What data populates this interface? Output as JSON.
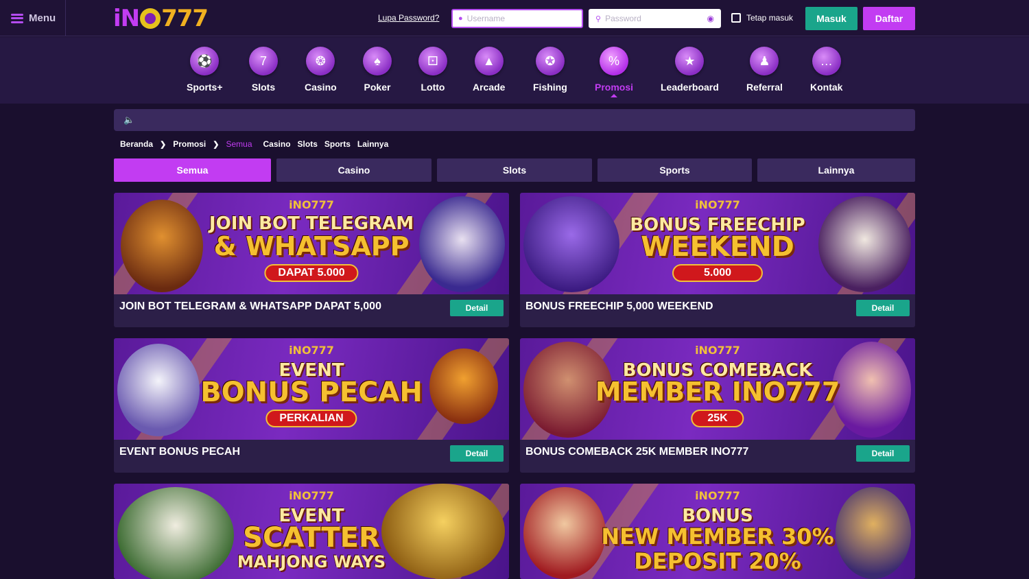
{
  "header": {
    "menu_label": "Menu",
    "logo_text_a": "iN",
    "logo_text_b": "777",
    "forgot_password": "Lupa Password?",
    "username_placeholder": "Username",
    "password_placeholder": "Password",
    "remember_label": "Tetap masuk",
    "login_label": "Masuk",
    "register_label": "Daftar"
  },
  "nav": [
    {
      "label": "Sports+",
      "icon": "sports-icon"
    },
    {
      "label": "Slots",
      "icon": "slots-icon"
    },
    {
      "label": "Casino",
      "icon": "casino-icon"
    },
    {
      "label": "Poker",
      "icon": "poker-icon"
    },
    {
      "label": "Lotto",
      "icon": "lotto-icon"
    },
    {
      "label": "Arcade",
      "icon": "arcade-icon"
    },
    {
      "label": "Fishing",
      "icon": "fishing-icon"
    },
    {
      "label": "Promosi",
      "icon": "promo-icon",
      "active": true
    },
    {
      "label": "Leaderboard",
      "icon": "trophy-icon"
    },
    {
      "label": "Referral",
      "icon": "referral-icon"
    },
    {
      "label": "Kontak",
      "icon": "chat-icon"
    }
  ],
  "breadcrumb": [
    "Beranda",
    "Promosi",
    "Semua",
    "Casino",
    "Slots",
    "Sports",
    "Lainnya"
  ],
  "tabs": [
    "Semua",
    "Casino",
    "Slots",
    "Sports",
    "Lainnya"
  ],
  "colors": {
    "accent": "#c23cf2",
    "green": "#1aa58b",
    "bg": "#1a0f2e"
  },
  "promos": [
    {
      "brand": "iNO777",
      "line1": "JOIN BOT TELEGRAM",
      "line2": "& WHATSAPP",
      "pill": "DAPAT 5.000",
      "title": "JOIN BOT TELEGRAM & WHATSAPP DAPAT 5,000",
      "detail": "Detail"
    },
    {
      "brand": "iNO777",
      "line1": "BONUS FREECHIP",
      "line2": "WEEKEND",
      "pill": "5.000",
      "title": "BONUS FREECHIP 5,000 WEEKEND",
      "detail": "Detail"
    },
    {
      "brand": "iNO777",
      "line1": "EVENT",
      "line2": "BONUS PECAH",
      "pill": "PERKALIAN",
      "title": "EVENT BONUS PECAH",
      "detail": "Detail"
    },
    {
      "brand": "iNO777",
      "line1": "BONUS COMEBACK",
      "line2": "MEMBER INO777",
      "pill": "25K",
      "title": "BONUS COMEBACK 25K MEMBER INO777",
      "detail": "Detail"
    },
    {
      "brand": "iNO777",
      "line1": "EVENT",
      "line2": "SCATTER",
      "line3": "MAHJONG WAYS",
      "title": "",
      "detail": ""
    },
    {
      "brand": "iNO777",
      "line1": "BONUS",
      "line2": "NEW MEMBER 30%",
      "line3": "DEPOSIT 20%",
      "title": "",
      "detail": ""
    }
  ]
}
